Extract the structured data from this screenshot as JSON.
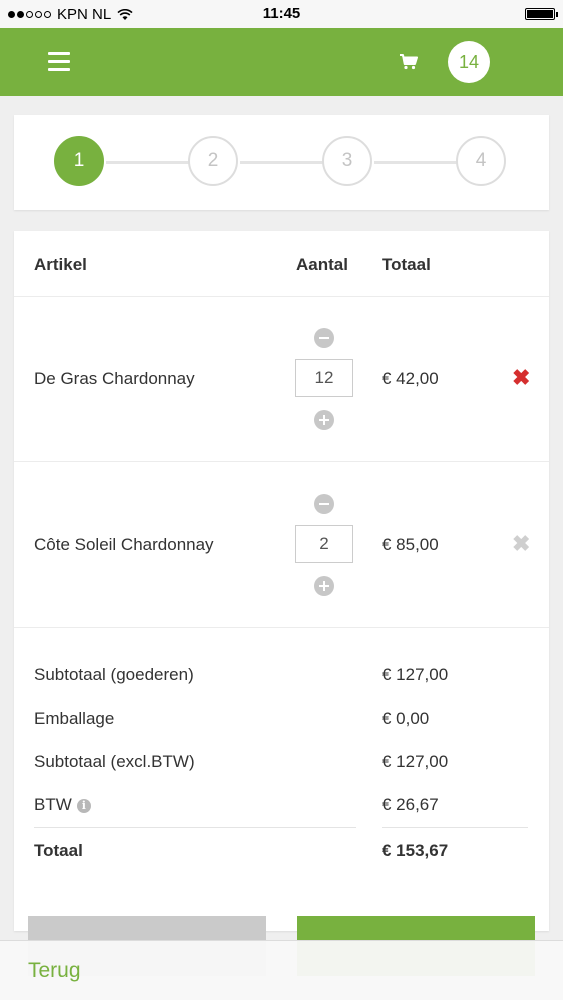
{
  "status_bar": {
    "carrier": "KPN NL",
    "time": "11:45",
    "signal_bars": 2,
    "signal_total": 5
  },
  "header": {
    "menu_icon": "hamburger-icon",
    "cart_icon": "cart-icon",
    "cart_count": "14",
    "accent_color": "#78b13f"
  },
  "steps": {
    "items": [
      "1",
      "2",
      "3",
      "4"
    ],
    "active_index": 0
  },
  "cart": {
    "columns": {
      "item": "Artikel",
      "quantity": "Aantal",
      "total": "Totaal"
    },
    "items": [
      {
        "name": "De Gras Chardonnay",
        "quantity": "12",
        "price": "€ 42,00",
        "remove_active": true
      },
      {
        "name": "Côte Soleil Chardonnay",
        "quantity": "2",
        "price": "€ 85,00",
        "remove_active": false
      }
    ]
  },
  "summary": {
    "subtotal_goods": {
      "label": "Subtotaal (goederen)",
      "value": "€ 127,00"
    },
    "packaging": {
      "label": "Emballage",
      "value": "€ 0,00"
    },
    "subtotal_excl_vat": {
      "label": "Subtotaal (excl.BTW)",
      "value": "€ 127,00"
    },
    "vat": {
      "label": "BTW",
      "value": "€ 26,67",
      "info_icon": "info-icon"
    },
    "total": {
      "label": "Totaal",
      "value": "€ 153,67"
    }
  },
  "bottom_bar": {
    "back_label": "Terug"
  }
}
